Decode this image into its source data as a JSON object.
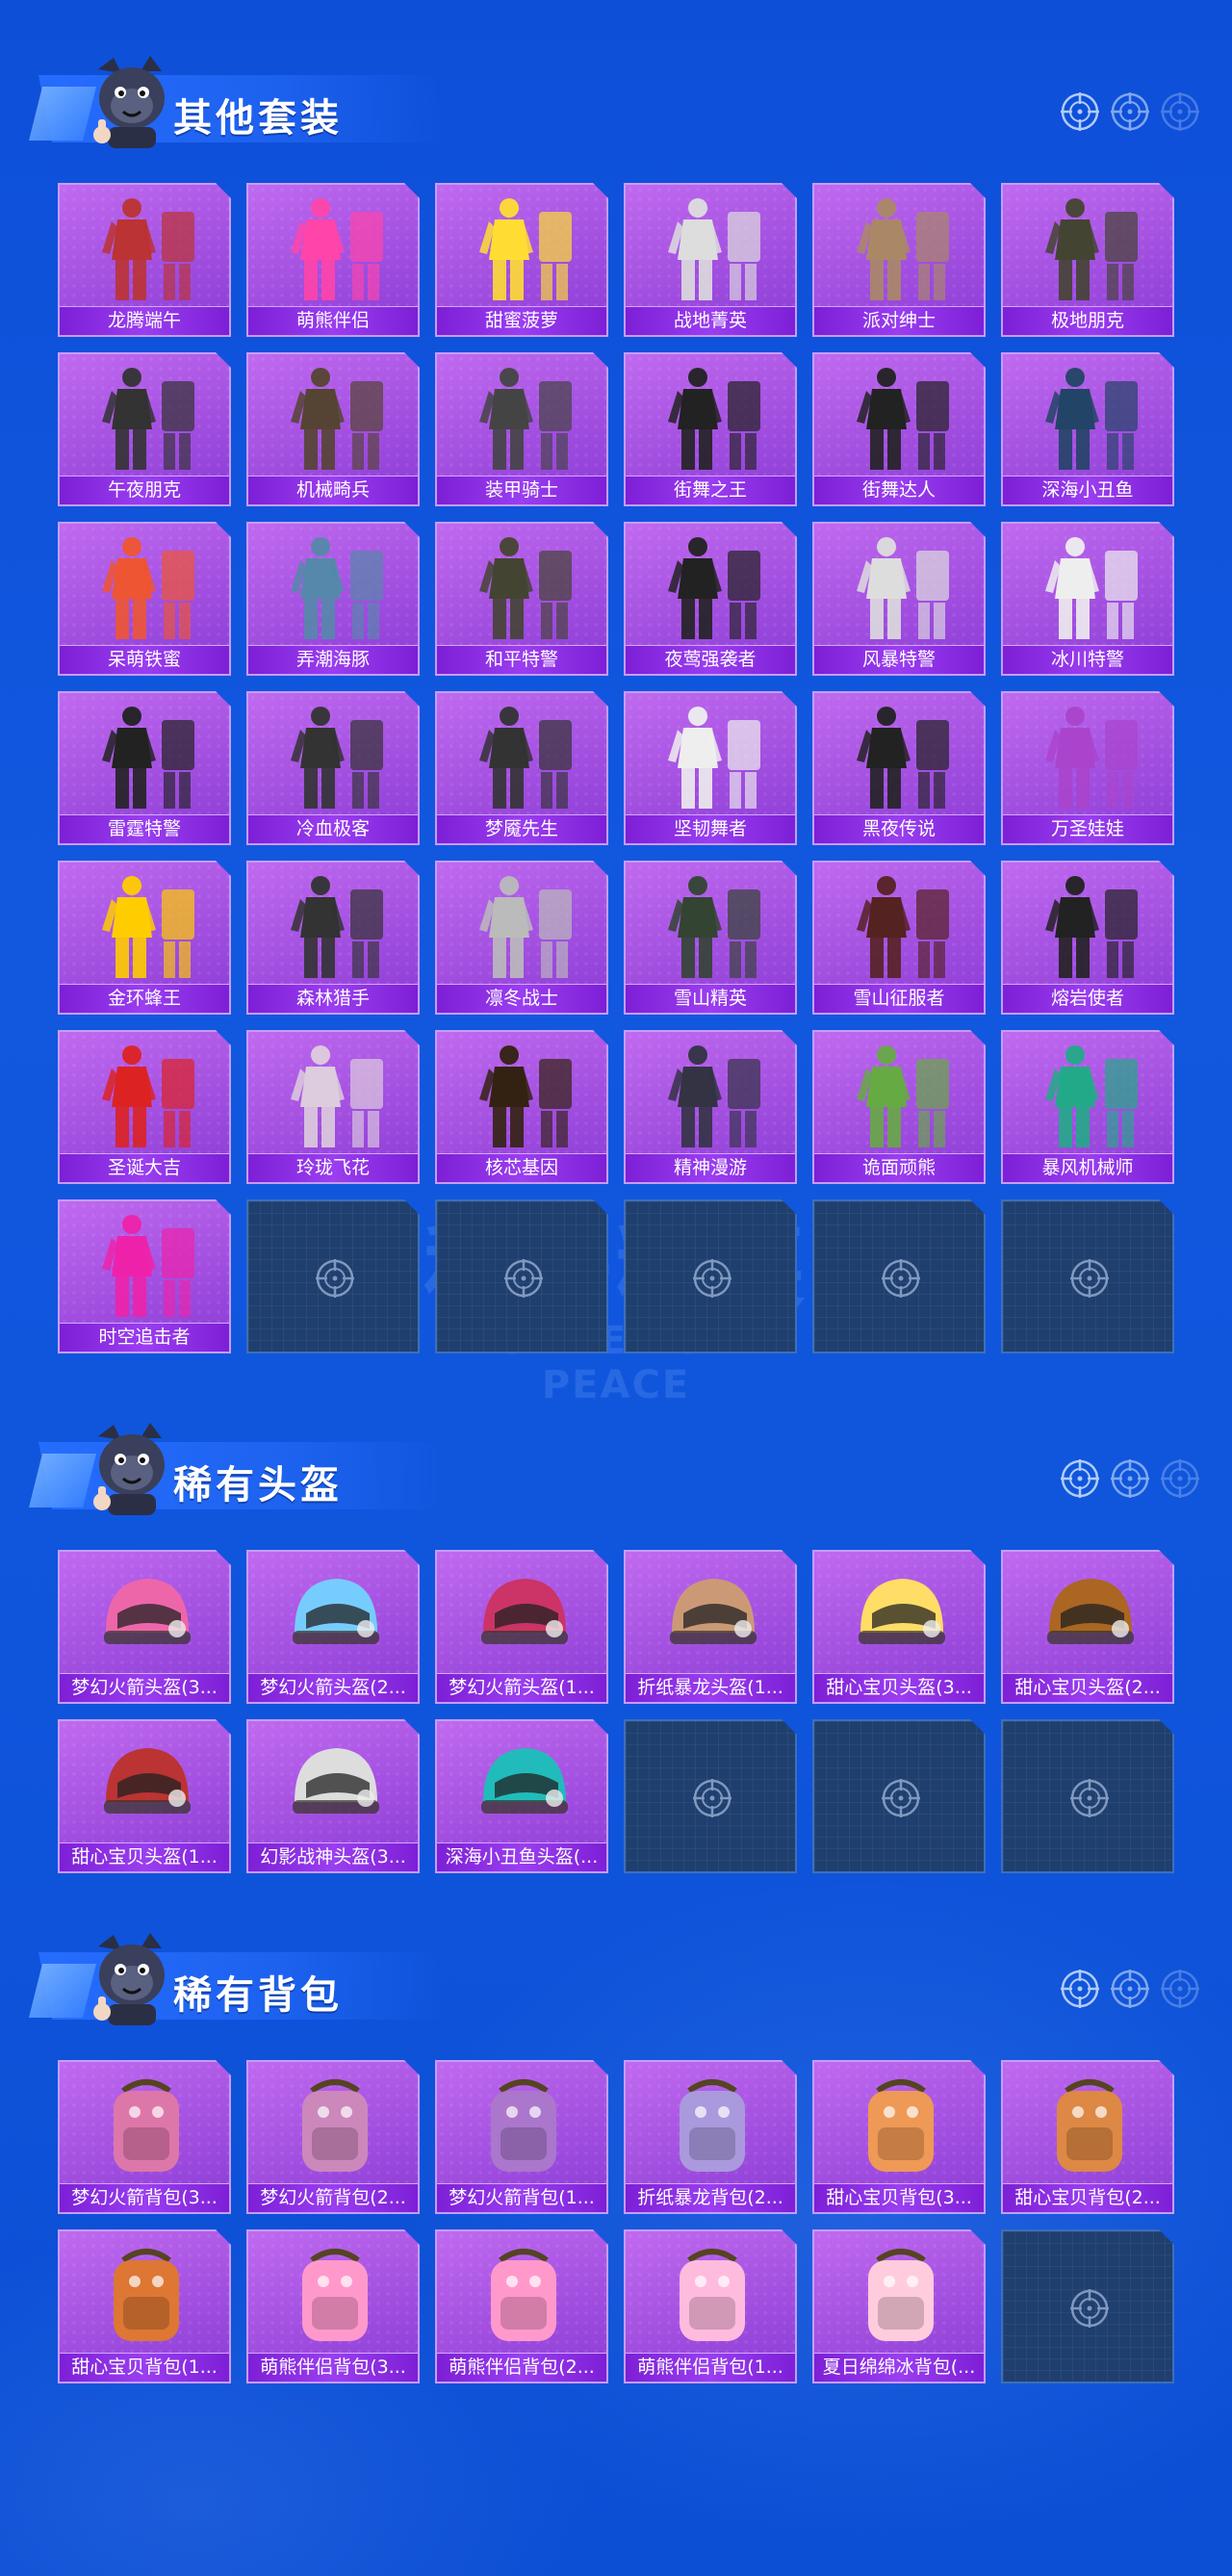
{
  "sections": [
    {
      "title": "其他套装",
      "item_icon": "outfit-icon",
      "items": [
        "龙腾端午",
        "萌熊伴侣",
        "甜蜜菠萝",
        "战地菁英",
        "派对绅士",
        "极地朋克",
        "午夜朋克",
        "机械畸兵",
        "装甲骑士",
        "街舞之王",
        "街舞达人",
        "深海小丑鱼",
        "呆萌铁蜜",
        "弄潮海豚",
        "和平特警",
        "夜莺强袭者",
        "风暴特警",
        "冰川特警",
        "雷霆特警",
        "冷血极客",
        "梦魇先生",
        "坚韧舞者",
        "黑夜传说",
        "万圣娃娃",
        "金环蜂王",
        "森林猎手",
        "凛冬战士",
        "雪山精英",
        "雪山征服者",
        "熔岩使者",
        "圣诞大吉",
        "玲珑飞花",
        "核芯基因",
        "精神漫游",
        "诡面顽熊",
        "暴风机械师",
        "时空追击者"
      ],
      "empty_slots": 5
    },
    {
      "title": "稀有头盔",
      "item_icon": "helmet-icon",
      "items": [
        "梦幻火箭头盔(3...",
        "梦幻火箭头盔(2...",
        "梦幻火箭头盔(1...",
        "折纸暴龙头盔(1...",
        "甜心宝贝头盔(3...",
        "甜心宝贝头盔(2...",
        "甜心宝贝头盔(1...",
        "幻影战神头盔(3...",
        "深海小丑鱼头盔(..."
      ],
      "empty_slots": 3
    },
    {
      "title": "稀有背包",
      "item_icon": "backpack-icon",
      "items": [
        "梦幻火箭背包(3...",
        "梦幻火箭背包(2...",
        "梦幻火箭背包(1...",
        "折纸暴龙背包(2...",
        "甜心宝贝背包(3...",
        "甜心宝贝背包(2...",
        "甜心宝贝背包(1...",
        "萌熊伴侣背包(3...",
        "萌熊伴侣背包(2...",
        "萌熊伴侣背包(1...",
        "夏日绵绵冰背包(..."
      ],
      "empty_slots": 1
    }
  ],
  "watermark": {
    "line1": "和平精英",
    "line2": "GAME FOR PEACE"
  },
  "colors": {
    "background": "#1158df",
    "card": "#a24fe0",
    "label_bar": "#8a2ee6",
    "empty_slot": "#1f3f6e"
  }
}
